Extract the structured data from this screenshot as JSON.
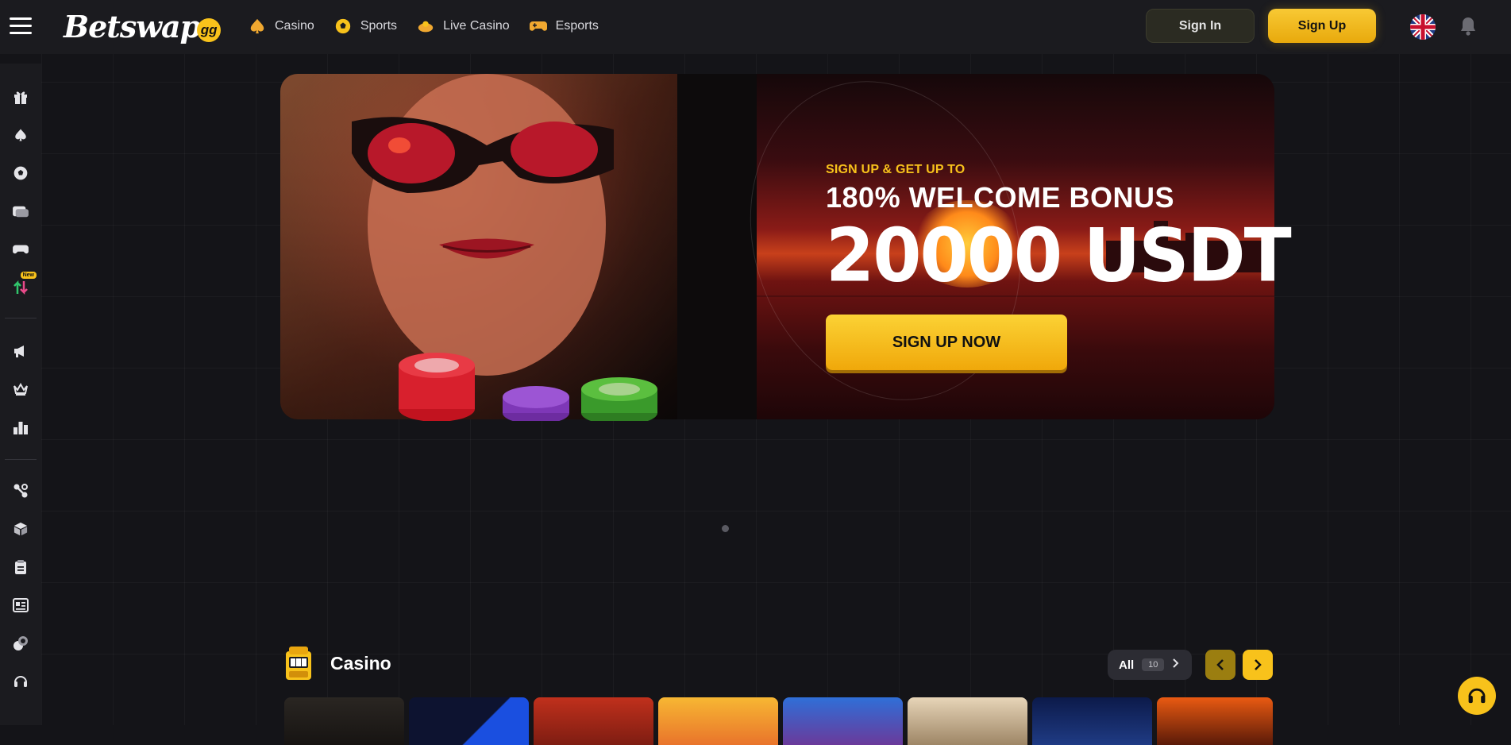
{
  "header": {
    "logo_text": "Betswap",
    "logo_badge": "gg",
    "nav": [
      {
        "label": "Casino",
        "icon": "spade-icon"
      },
      {
        "label": "Sports",
        "icon": "soccer-ball-icon"
      },
      {
        "label": "Live Casino",
        "icon": "live-dealer-icon"
      },
      {
        "label": "Esports",
        "icon": "gamepad-icon"
      }
    ],
    "sign_in": "Sign In",
    "sign_up": "Sign Up",
    "language_icon": "uk-flag-icon",
    "notifications_icon": "bell-icon"
  },
  "sidebar": {
    "new_badge": "New",
    "items": [
      "gift-icon",
      "spade-icon",
      "soccer-ball-icon",
      "live-dealer-icon",
      "gamepad-icon",
      "swap-arrows-icon",
      "megaphone-icon",
      "crown-icon",
      "leaderboard-icon",
      "link-icon",
      "box-icon",
      "clipboard-icon",
      "news-icon",
      "coins-icon",
      "headset-icon"
    ]
  },
  "banner": {
    "subtitle": "SIGN UP & GET  UP TO",
    "title": "180% WELCOME BONUS",
    "amount": "20000 USDT",
    "cta": "SIGN UP NOW"
  },
  "casino_section": {
    "title": "Casino",
    "all_label": "All",
    "count": "10"
  },
  "colors": {
    "accent": "#f8c21b",
    "background": "#141418",
    "panel": "#1b1b1f"
  }
}
